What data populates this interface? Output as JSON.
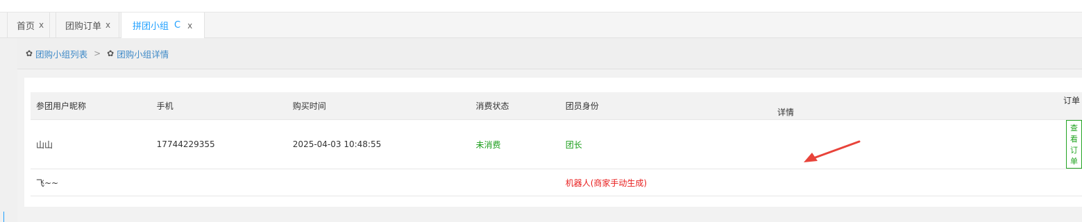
{
  "tabs": [
    {
      "label": "首页",
      "close": "x"
    },
    {
      "label": "团购订单",
      "close": "x"
    },
    {
      "label": "拼团小组",
      "refresh": "C",
      "close": "x"
    }
  ],
  "breadcrumb": [
    {
      "label": "团购小组列表",
      "icon": "gear-icon"
    },
    {
      "label": "团购小组详情",
      "icon": "gear-icon"
    }
  ],
  "breadcrumb_separator": ">",
  "table": {
    "headers": [
      "参团用户昵称",
      "手机",
      "购买时间",
      "消费状态",
      "团员身份",
      "订单详情"
    ],
    "rows": [
      {
        "nickname": "山山",
        "phone": "17744229355",
        "time": "2025-04-03 10:48:55",
        "status": "未消费",
        "role": "团长",
        "action": "查看订单"
      },
      {
        "nickname": "飞~~",
        "phone": "",
        "time": "",
        "status": "",
        "role": "机器人(商家手动生成)",
        "action": ""
      }
    ]
  },
  "colors": {
    "accent": "#1e9fff",
    "green": "#1a9d1a",
    "red": "#e81c1c",
    "arrow": "#e8433a"
  }
}
